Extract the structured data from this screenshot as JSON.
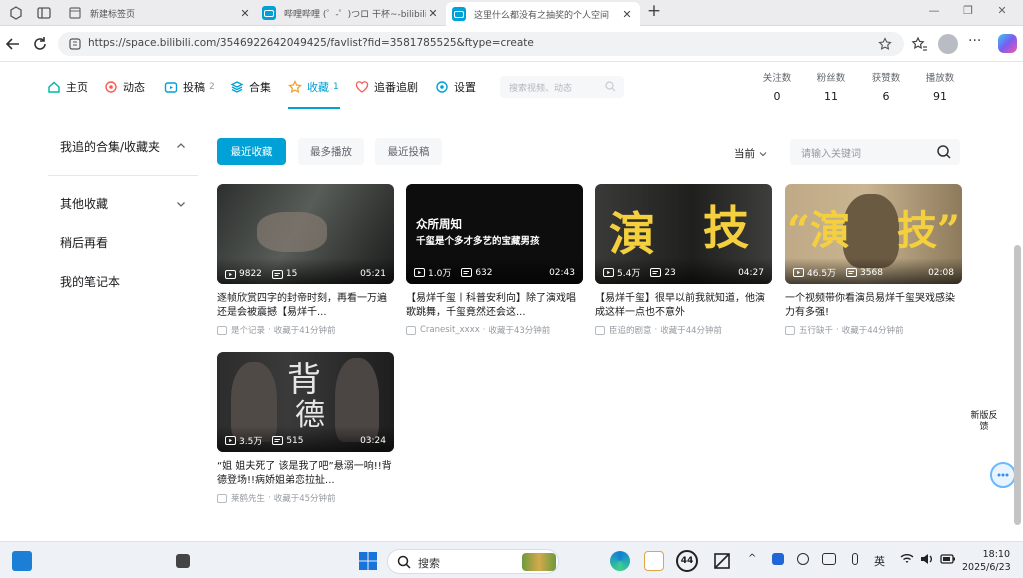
{
  "browser": {
    "tabs": [
      {
        "title": "新建标签页",
        "active": false
      },
      {
        "title": "哔哩哔哩 (゜-゜)つロ 干杯~-bilibili",
        "active": false
      },
      {
        "title": "这里什么都没有之抽奖的个人空间",
        "active": true
      }
    ],
    "new_tab_label": "+",
    "url": "https://space.bilibili.com/3546922642049425/favlist?fid=3581785525&ftype=create"
  },
  "space_nav": {
    "items": [
      {
        "label": "主页",
        "count": "",
        "active": false
      },
      {
        "label": "动态",
        "count": "",
        "active": false
      },
      {
        "label": "投稿",
        "count": "2",
        "active": false
      },
      {
        "label": "合集",
        "count": "",
        "active": false
      },
      {
        "label": "收藏",
        "count": "1",
        "active": true
      },
      {
        "label": "追番追剧",
        "count": "",
        "active": false
      },
      {
        "label": "设置",
        "count": "",
        "active": false
      }
    ],
    "search_placeholder": "搜索视频、动态",
    "stats": [
      {
        "label": "关注数",
        "value": "0"
      },
      {
        "label": "粉丝数",
        "value": "11"
      },
      {
        "label": "获赞数",
        "value": "6"
      },
      {
        "label": "播放数",
        "value": "91"
      }
    ]
  },
  "sidebar": {
    "header": "我追的合集/收藏夹",
    "items": [
      "其他收藏",
      "稍后再看",
      "我的笔记本"
    ]
  },
  "filters": {
    "buttons": [
      "最近收藏",
      "最多播放",
      "最近投稿"
    ],
    "active_index": 0,
    "sort_label": "当前",
    "keyword_placeholder": "请输入关键词"
  },
  "videos": [
    {
      "plays": "9822",
      "danmaku": "15",
      "duration": "05:21",
      "title": "逐帧欣赏四字的封帝时刻，再看一万遍还是会被震撼【易烊千...",
      "uploader": "是个记录",
      "saved": "收藏于41分钟前"
    },
    {
      "plays": "1.0万",
      "danmaku": "632",
      "duration": "02:43",
      "title": "【易烊千玺丨科普安利向】除了演戏唱歌跳舞，千玺竟然还会这...",
      "uploader": "Cranesit_xxxx",
      "saved": "收藏于43分钟前",
      "overlay_text": [
        "众所周知",
        "千玺是个多才多艺的宝藏男孩"
      ]
    },
    {
      "plays": "5.4万",
      "danmaku": "23",
      "duration": "04:27",
      "title": "【易烊千玺】很早以前我就知道，他演成这样一点也不意外",
      "uploader": "臣追的剧意",
      "saved": "收藏于44分钟前",
      "overlay_text": [
        "演",
        "技"
      ]
    },
    {
      "plays": "46.5万",
      "danmaku": "3568",
      "duration": "02:08",
      "title": "一个视频带你看演员易烊千玺哭戏感染力有多强!",
      "uploader": "五行缺千",
      "saved": "收藏于44分钟前",
      "overlay_text": [
        "“演",
        "技”"
      ]
    },
    {
      "plays": "3.5万",
      "danmaku": "515",
      "duration": "03:24",
      "title": "“姐 姐夫死了 该是我了吧”悬溺一响!!背德登场!!病娇姐弟恋拉扯...",
      "uploader": "莱鹤先生",
      "saved": "收藏于45分钟前",
      "overlay_text": [
        "背",
        "德"
      ]
    }
  ],
  "floating": {
    "feedback": "新版反馈"
  },
  "taskbar": {
    "search_label": "搜索",
    "badge": "44",
    "ime": "英",
    "time": "18:10",
    "date": "2025/6/23"
  }
}
